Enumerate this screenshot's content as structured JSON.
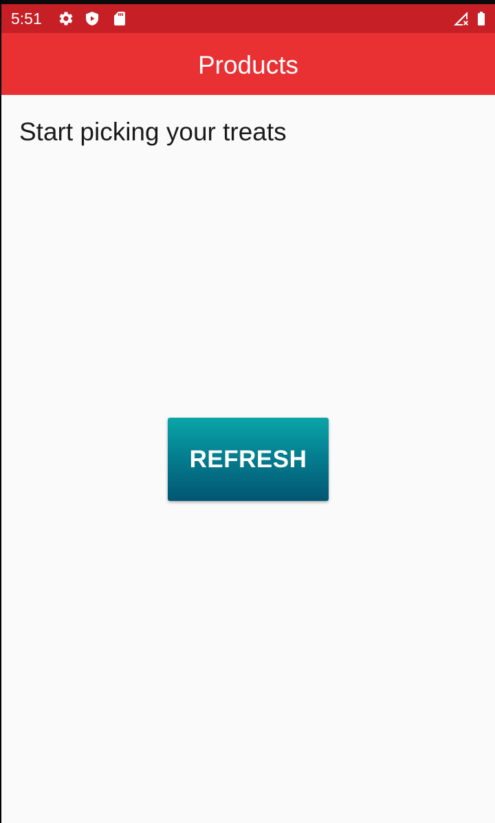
{
  "status_bar": {
    "time": "5:51",
    "icons": [
      "gear-icon",
      "shield-icon",
      "sd-card-icon",
      "signal-icon",
      "battery-icon"
    ],
    "color": "#c62026"
  },
  "app_bar": {
    "title": "Products",
    "color": "#e93134"
  },
  "main": {
    "prompt": "Start picking your treats",
    "refresh_label": "REFRESH",
    "button_gradient": [
      "#0aa5a8",
      "#025672"
    ]
  }
}
